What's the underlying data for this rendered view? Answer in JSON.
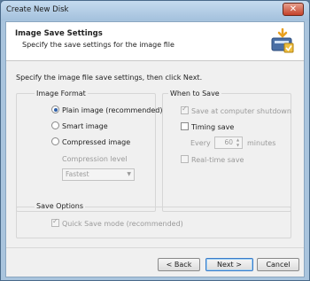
{
  "window": {
    "title": "Create New Disk",
    "close_glyph": "✕"
  },
  "header": {
    "title": "Image Save Settings",
    "subtitle": "Specify the save settings for the image file",
    "icon": "disk-wizard-icon"
  },
  "intro": "Specify the image file save settings, then click Next.",
  "image_format": {
    "label": "Image Format",
    "options": [
      {
        "label": "Plain image (recommended)",
        "selected": true
      },
      {
        "label": "Smart image",
        "selected": false
      },
      {
        "label": "Compressed image",
        "selected": false
      }
    ],
    "compression_label": "Compression level",
    "compression_value": "Fastest"
  },
  "when_to_save": {
    "label": "When to Save",
    "shutdown_label": "Save at computer shutdown",
    "timing_label": "Timing save",
    "every_label": "Every",
    "every_value": "60",
    "minutes_label": "minutes",
    "realtime_label": "Real-time save"
  },
  "save_options": {
    "label": "Save Options",
    "quick_save_label": "Quick Save mode (recommended)"
  },
  "buttons": {
    "back": "< Back",
    "next": "Next >",
    "cancel": "Cancel"
  }
}
